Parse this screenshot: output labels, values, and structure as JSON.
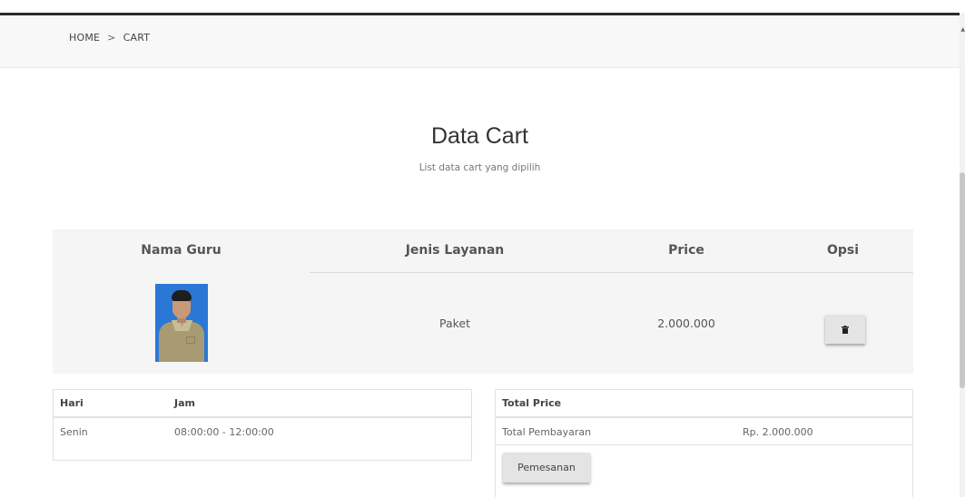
{
  "breadcrumb": {
    "home": "HOME",
    "separator": ">",
    "current": "CART"
  },
  "section": {
    "title": "Data Cart",
    "subtitle": "List data cart yang dipilih"
  },
  "cart_table": {
    "headers": {
      "guru": "Nama Guru",
      "layanan": "Jenis Layanan",
      "price": "Price",
      "opsi": "Opsi"
    },
    "rows": [
      {
        "guru_photo": "teacher-photo",
        "layanan": "Paket",
        "price": "2.000.000",
        "opsi_icon": "trash-icon"
      }
    ]
  },
  "schedule_table": {
    "headers": {
      "hari": "Hari",
      "jam": "Jam"
    },
    "rows": [
      {
        "hari": "Senin",
        "jam": "08:00:00 - 12:00:00"
      }
    ]
  },
  "total_table": {
    "header": "Total Price",
    "label": "Total Pembayaran",
    "value": "Rp. 2.000.000",
    "button_label": "Pemesanan"
  },
  "colors": {
    "panel_bg": "#f5f5f5",
    "button_bg": "#e4e4e4",
    "photo_bg": "#2a78d6"
  }
}
